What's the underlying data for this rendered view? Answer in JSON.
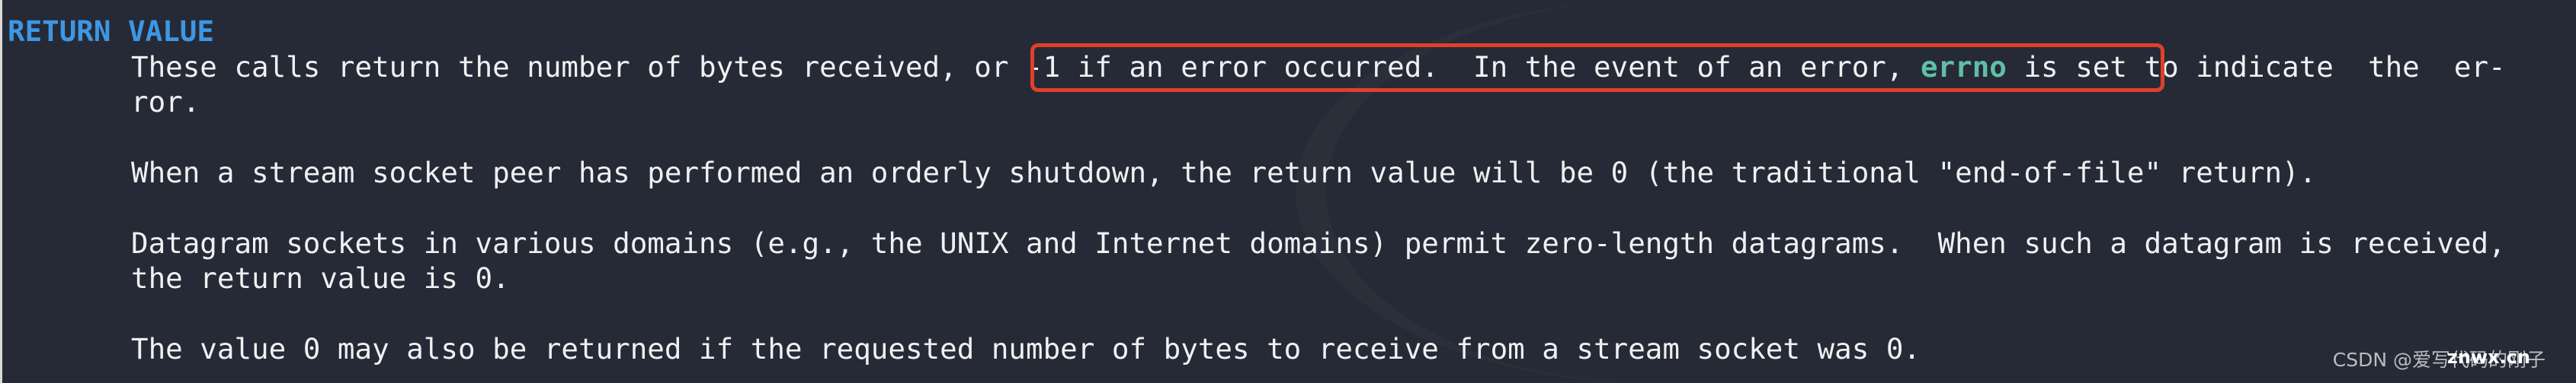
{
  "section": {
    "heading": "RETURN VALUE"
  },
  "paragraphs": {
    "p1_line1_a": "These calls return the number of bytes received, or ",
    "p1_line1_b": "-1 if an error occurred.  In the event of an error, ",
    "p1_line1_cmd": "errno",
    "p1_line1_c": " is set",
    "p1_line1_d": " to indicate  the  er-",
    "p1_line2": "ror.",
    "p2_line1": "When a stream socket peer has performed an orderly shutdown, the return value will be 0 (the traditional \"end-of-file\" return).",
    "p3_line1": "Datagram sockets in various domains (e.g., the UNIX and Internet domains) permit zero-length datagrams.  When such a datagram is received,",
    "p3_line2": "the return value is 0.",
    "p4_line1": "The value 0 may also be returned if the requested number of bytes to receive from a stream socket was 0."
  },
  "annotation": {
    "highlight_color": "#e0402a"
  },
  "colors": {
    "background": "#262a36",
    "heading": "#3d97e4",
    "command": "#5fbfa6",
    "text": "#eef0f2"
  },
  "watermark": {
    "text": "CSDN @爱写代码的刚子",
    "overlay": "znwx.cn"
  }
}
